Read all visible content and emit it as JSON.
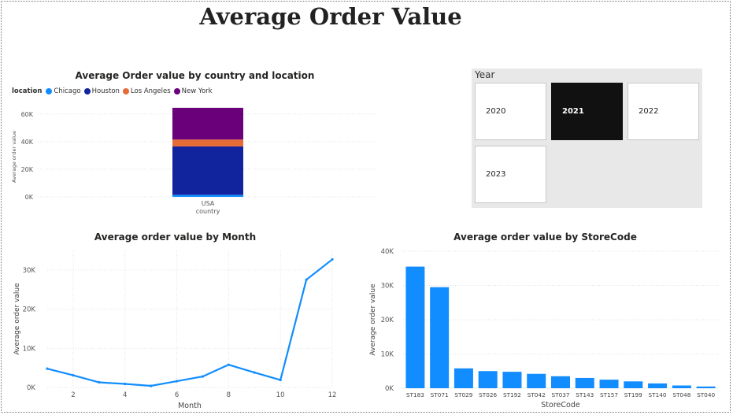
{
  "page": {
    "title": "Average Order Value"
  },
  "slicer": {
    "title": "Year",
    "options": [
      "2020",
      "2021",
      "2022",
      "2023"
    ],
    "selected": "2021",
    "selected_color": "#111111"
  },
  "chart_data": [
    {
      "type": "bar",
      "stacked": true,
      "title": "Average Order value by country and location",
      "xlabel": "country",
      "ylabel": "Average order value",
      "categories": [
        "USA"
      ],
      "legend_title": "location",
      "legend_position": "top-left",
      "ylim": [
        0,
        65000
      ],
      "yticks": [
        0,
        20000,
        40000,
        60000
      ],
      "ytick_labels": [
        "0K",
        "20K",
        "40K",
        "60K"
      ],
      "grid": true,
      "series": [
        {
          "name": "Chicago",
          "color": "#118DFF",
          "values": [
            1500
          ]
        },
        {
          "name": "Houston",
          "color": "#12239E",
          "values": [
            35000
          ]
        },
        {
          "name": "Los Angeles",
          "color": "#E66C37",
          "values": [
            5000
          ]
        },
        {
          "name": "New York",
          "color": "#6B007B",
          "values": [
            23000
          ]
        }
      ]
    },
    {
      "type": "line",
      "title": "Average order value by Month",
      "xlabel": "Month",
      "ylabel": "Average order value",
      "color": "#118DFF",
      "x": [
        1,
        2,
        3,
        4,
        5,
        6,
        7,
        8,
        9,
        10,
        11,
        12
      ],
      "values": [
        4800,
        3100,
        1300,
        900,
        400,
        1600,
        2800,
        5800,
        3800,
        1900,
        27500,
        32700
      ],
      "xlim": [
        1,
        12
      ],
      "xticks": [
        2,
        4,
        6,
        8,
        10,
        12
      ],
      "ylim": [
        0,
        35000
      ],
      "yticks": [
        0,
        10000,
        20000,
        30000
      ],
      "ytick_labels": [
        "0K",
        "10K",
        "20K",
        "30K"
      ],
      "grid": true
    },
    {
      "type": "bar",
      "title": "Average order value by StoreCode",
      "xlabel": "StoreCode",
      "ylabel": "Average order value",
      "color": "#118DFF",
      "categories": [
        "ST183",
        "ST071",
        "ST029",
        "ST026",
        "ST192",
        "ST042",
        "ST037",
        "ST143",
        "ST157",
        "ST199",
        "ST140",
        "ST048",
        "ST040"
      ],
      "values": [
        35500,
        29500,
        5800,
        5000,
        4800,
        4200,
        3500,
        3000,
        2500,
        2000,
        1400,
        800,
        500
      ],
      "ylim": [
        0,
        40000
      ],
      "yticks": [
        0,
        10000,
        20000,
        30000,
        40000
      ],
      "ytick_labels": [
        "0K",
        "10K",
        "20K",
        "30K",
        "40K"
      ],
      "grid": true
    }
  ]
}
